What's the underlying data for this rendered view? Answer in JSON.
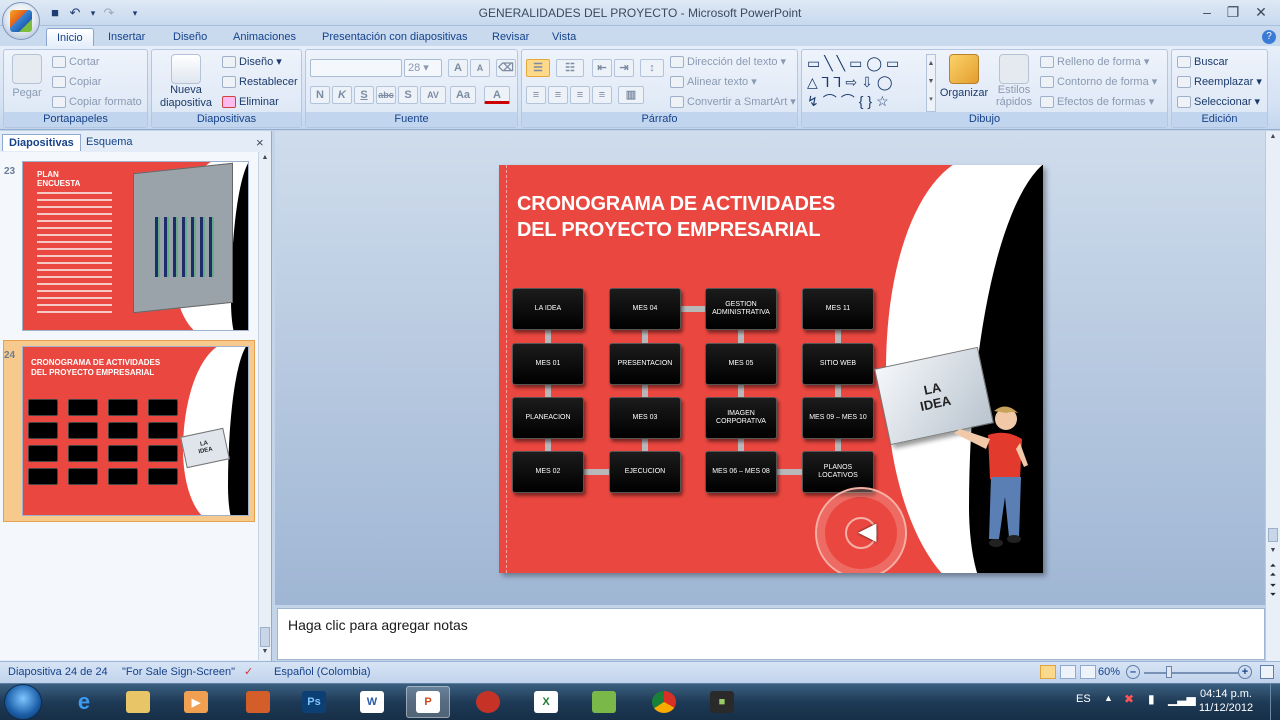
{
  "window": {
    "title": "GENERALIDADES DEL PROYECTO - Microsoft PowerPoint"
  },
  "tabs": [
    "Inicio",
    "Insertar",
    "Diseño",
    "Animaciones",
    "Presentación con diapositivas",
    "Revisar",
    "Vista"
  ],
  "ribbon": {
    "portapapeles": {
      "label": "Portapapeles",
      "paste": "Pegar",
      "cut": "Cortar",
      "copy": "Copiar",
      "format_painter": "Copiar formato"
    },
    "diapositivas": {
      "label": "Diapositivas",
      "new_slide_1": "Nueva",
      "new_slide_2": "diapositiva",
      "layout": "Diseño",
      "reset": "Restablecer",
      "delete": "Eliminar"
    },
    "fuente": {
      "label": "Fuente",
      "font_size": "28",
      "bold": "N",
      "italic": "K",
      "underline": "S",
      "strike": "abc",
      "shadow": "S",
      "spacing": "AV",
      "case": "Aa",
      "grow": "A",
      "shrink": "A"
    },
    "parrafo": {
      "label": "Párrafo",
      "text_direction": "Dirección del texto",
      "align_text": "Alinear texto",
      "smartart": "Convertir a SmartArt"
    },
    "dibujo": {
      "label": "Dibujo",
      "arrange": "Organizar",
      "quick_styles_1": "Estilos",
      "quick_styles_2": "rápidos",
      "fill": "Relleno de forma",
      "outline": "Contorno de forma",
      "effects": "Efectos de formas"
    },
    "edicion": {
      "label": "Edición",
      "find": "Buscar",
      "replace": "Reemplazar",
      "select": "Seleccionar"
    }
  },
  "left_pane": {
    "tabs": [
      "Diapositivas",
      "Esquema"
    ],
    "close": "×",
    "thumbs": [
      {
        "number": "23",
        "title_1": "PLAN",
        "title_2": "ENCUESTA"
      },
      {
        "number": "24",
        "title_1": "CRONOGRAMA DE ACTIVIDADES",
        "title_2": "DEL PROYECTO EMPRESARIAL",
        "card_1": "LA",
        "card_2": "IDEA"
      }
    ]
  },
  "slide": {
    "title_1": "CRONOGRAMA DE ACTIVIDADES",
    "title_2": "DEL PROYECTO EMPRESARIAL",
    "nodes": [
      [
        "LA IDEA",
        "MES 04",
        "GESTION ADMINISTRATIVA",
        "MES 11"
      ],
      [
        "MES 01",
        "PRESENTACION",
        "MES 05",
        "SITIO WEB"
      ],
      [
        "PLANEACION",
        "MES 03",
        "IMAGEN CORPORATIVA",
        "MES 09 – MES 10"
      ],
      [
        "MES 02",
        "EJECUCION",
        "MES 06 – MES 08",
        "PLANOS LOCATIVOS"
      ]
    ],
    "card_1": "LA",
    "card_2": "IDEA"
  },
  "notes": {
    "placeholder": "Haga clic para agregar notas"
  },
  "status": {
    "slide_counter": "Diapositiva 24 de 24",
    "theme": "\"For Sale Sign-Screen\"",
    "language": "Español (Colombia)",
    "zoom": "60%"
  },
  "taskbar": {
    "lang": "ES",
    "time": "04:14 p.m.",
    "date": "11/12/2012"
  },
  "colors": {
    "slide_red": "#e9473f",
    "ribbon_blue": "#15428b"
  }
}
